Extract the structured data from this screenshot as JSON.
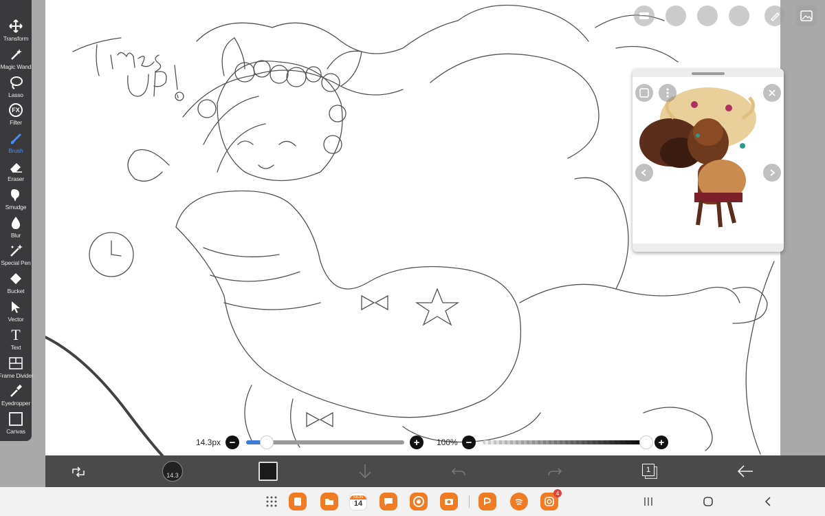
{
  "toolbar": {
    "items": [
      {
        "label": "Transform",
        "icon": "transform-icon"
      },
      {
        "label": "Magic Wand",
        "icon": "magic-wand-icon"
      },
      {
        "label": "Lasso",
        "icon": "lasso-icon"
      },
      {
        "label": "Filter",
        "icon": "fx-icon"
      },
      {
        "label": "Brush",
        "icon": "brush-icon",
        "active": true
      },
      {
        "label": "Eraser",
        "icon": "eraser-icon"
      },
      {
        "label": "Smudge",
        "icon": "smudge-icon"
      },
      {
        "label": "Blur",
        "icon": "blur-icon"
      },
      {
        "label": "Special Pen",
        "icon": "special-pen-icon"
      },
      {
        "label": "Bucket",
        "icon": "bucket-icon"
      },
      {
        "label": "Vector",
        "icon": "vector-icon"
      },
      {
        "label": "Text",
        "icon": "text-icon"
      },
      {
        "label": "Frame Divider",
        "icon": "frame-divider-icon"
      },
      {
        "label": "Eyedropper",
        "icon": "eyedropper-icon"
      },
      {
        "label": "Canvas",
        "icon": "canvas-icon"
      }
    ],
    "fx_glyph": "FX",
    "text_glyph": "T"
  },
  "brush_size": {
    "label": "14.3px",
    "fill": 0.1,
    "minus": "−",
    "plus": "+"
  },
  "opacity": {
    "label": "100%",
    "fill": 1.0,
    "minus": "−",
    "plus": "+"
  },
  "bottom": {
    "brush_preview_value": "14.3",
    "layer_count": "1",
    "color_swatch": "#1a1a1a"
  },
  "dock": {
    "calendar_day": "MON",
    "calendar_date": "14",
    "instagram_badge": "4"
  },
  "colors": {
    "toolbar_bg": "#3a3a3c",
    "active_tool": "#4e8df5",
    "slider_blue": "#3d7bd8",
    "bottom_bar": "#4a4a4a"
  }
}
